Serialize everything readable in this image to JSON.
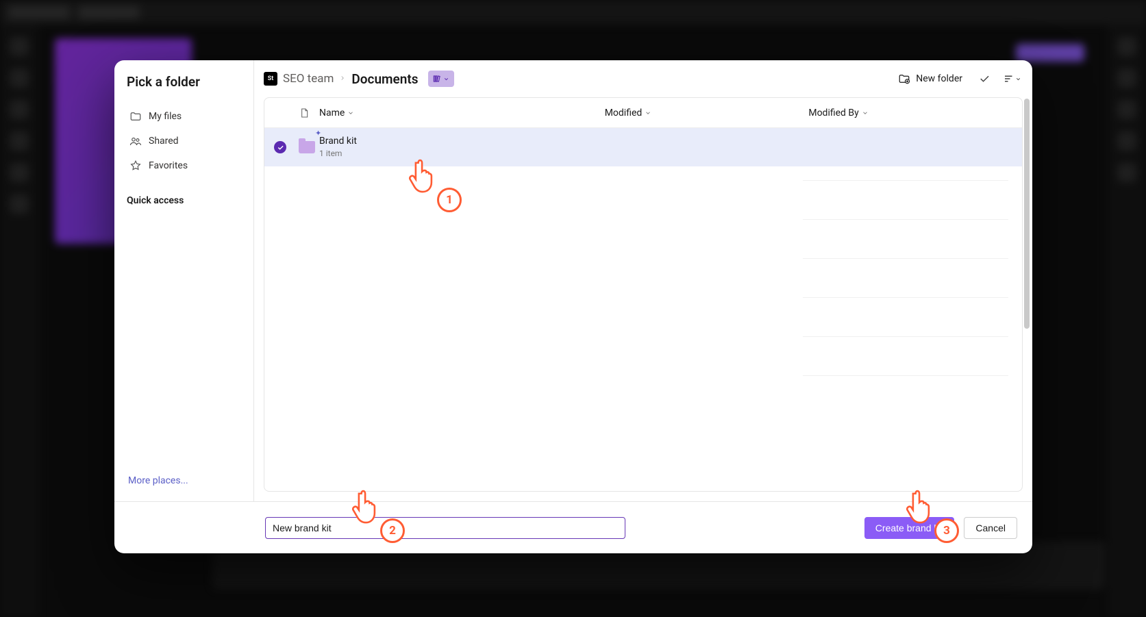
{
  "sidebar": {
    "title": "Pick a folder",
    "nav": {
      "my_files": "My files",
      "shared": "Shared",
      "favorites": "Favorites"
    },
    "quick_access_label": "Quick access",
    "more_places": "More places..."
  },
  "breadcrumb": {
    "root_badge": "St",
    "root": "SEO team",
    "current": "Documents"
  },
  "toolbar": {
    "new_folder": "New folder"
  },
  "columns": {
    "name": "Name",
    "modified": "Modified",
    "modified_by": "Modified By"
  },
  "rows": [
    {
      "name": "Brand kit",
      "sub": "1 item",
      "modified": "",
      "modified_by": ""
    }
  ],
  "footer": {
    "input_value": "New brand kit",
    "create": "Create brand kit",
    "cancel": "Cancel"
  },
  "annotations": {
    "a1": "1",
    "a2": "2",
    "a3": "3"
  }
}
